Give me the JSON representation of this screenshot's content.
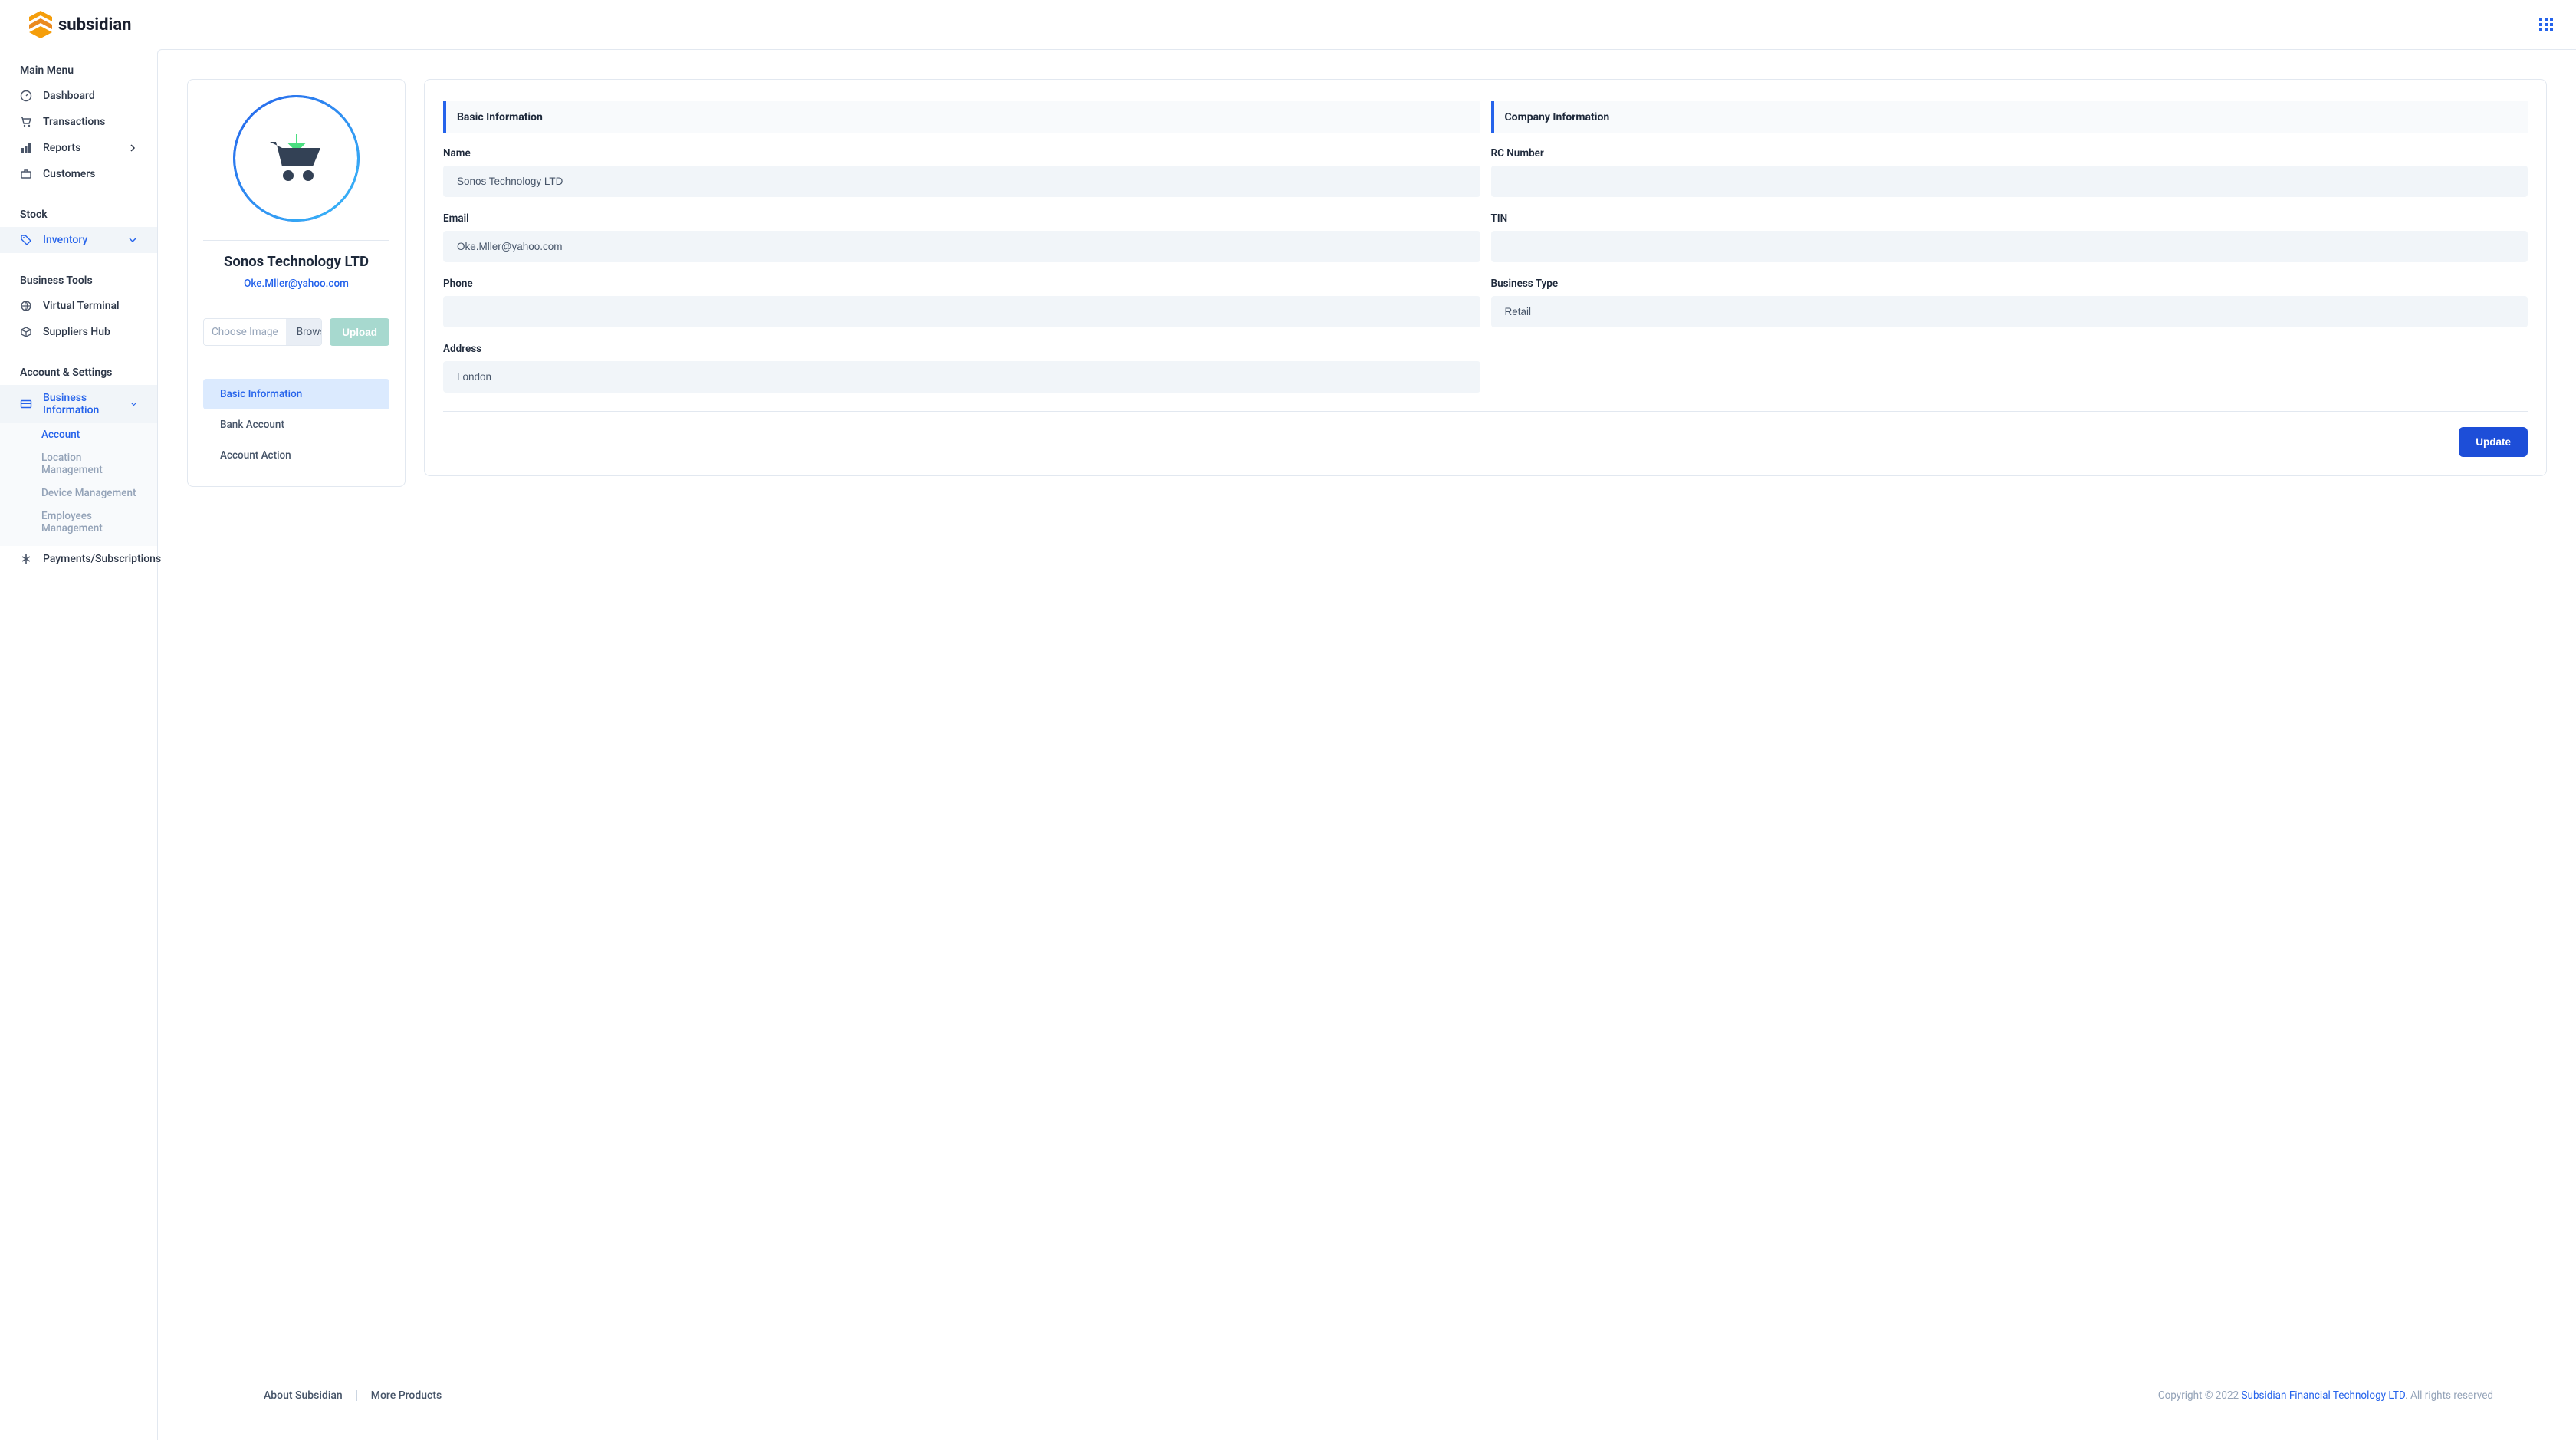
{
  "brand": {
    "name": "subsidian"
  },
  "sidebar": {
    "sections": {
      "main": {
        "header": "Main Menu",
        "items": [
          {
            "label": "Dashboard"
          },
          {
            "label": "Transactions"
          },
          {
            "label": "Reports"
          },
          {
            "label": "Customers"
          }
        ]
      },
      "stock": {
        "header": "Stock",
        "items": [
          {
            "label": "Inventory"
          }
        ]
      },
      "tools": {
        "header": "Business Tools",
        "items": [
          {
            "label": "Virtual Terminal"
          },
          {
            "label": "Suppliers Hub"
          }
        ]
      },
      "settings": {
        "header": "Account & Settings",
        "items": [
          {
            "label": "Business Information",
            "sub": [
              {
                "label": "Account"
              },
              {
                "label": "Location Management"
              },
              {
                "label": "Device Management"
              },
              {
                "label": "Employees Management"
              }
            ]
          },
          {
            "label": "Payments/Subscriptions"
          }
        ]
      }
    }
  },
  "profile": {
    "name": "Sonos Technology LTD",
    "email": "Oke.Mller@yahoo.com",
    "choose_placeholder": "Choose Image",
    "browse_label": "Browse",
    "upload_label": "Upload",
    "tabs": [
      {
        "label": "Basic Information"
      },
      {
        "label": "Bank Account"
      },
      {
        "label": "Account Action"
      }
    ]
  },
  "form": {
    "basic_title": "Basic Information",
    "company_title": "Company Information",
    "name_label": "Name",
    "name_value": "Sonos Technology LTD",
    "email_label": "Email",
    "email_value": "Oke.Mller@yahoo.com",
    "phone_label": "Phone",
    "phone_value": "",
    "address_label": "Address",
    "address_value": "London",
    "rc_label": "RC Number",
    "rc_value": "",
    "tin_label": "TIN",
    "tin_value": "",
    "biztype_label": "Business Type",
    "biztype_value": "Retail",
    "update_label": "Update"
  },
  "footer": {
    "about": "About Subsidian",
    "more": "More Products",
    "copyright_prefix": "Copyright © 2022 ",
    "company": "Subsidian Financial Technology LTD",
    "copyright_suffix": ". All rights reserved"
  }
}
